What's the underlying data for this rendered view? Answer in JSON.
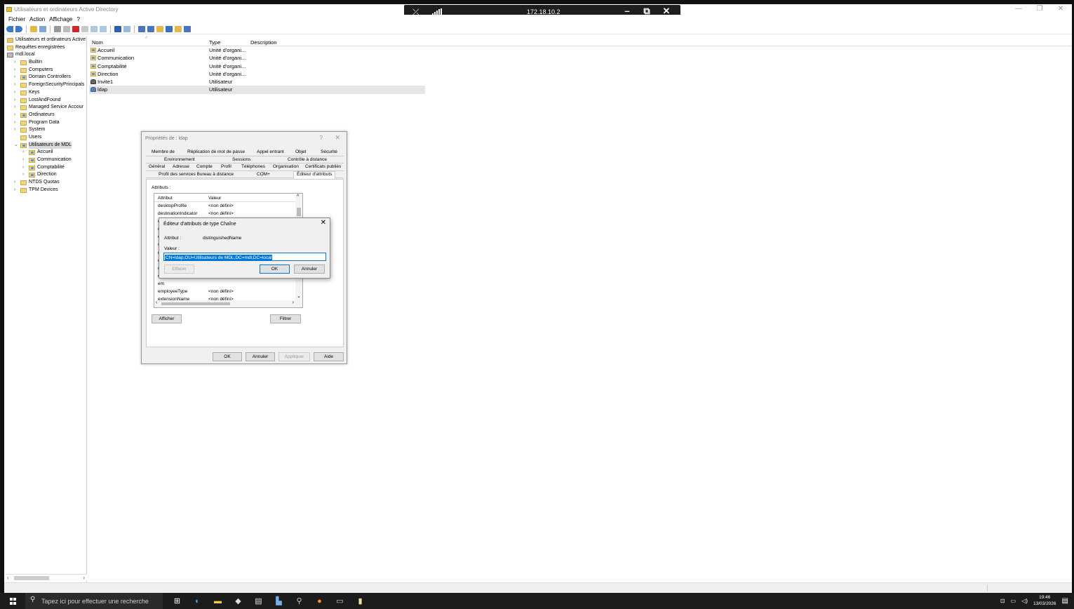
{
  "window": {
    "title": "Utilisateurs et ordinateurs Active Directory"
  },
  "rdp": {
    "ip": "172.18.10.2"
  },
  "menu": [
    "Fichier",
    "Action",
    "Affichage",
    "?"
  ],
  "tree": {
    "items": [
      {
        "label": "Utilisateurs et ordinateurs Active",
        "level": 0,
        "arrow": "",
        "icon": "root"
      },
      {
        "label": "Requêtes enregistrées",
        "level": 0,
        "arrow": "›",
        "icon": "folder"
      },
      {
        "label": "mdl.local",
        "level": 0,
        "arrow": "⌄",
        "icon": "domain"
      },
      {
        "label": "Builtin",
        "level": 1,
        "arrow": "›",
        "icon": "folder"
      },
      {
        "label": "Computers",
        "level": 1,
        "arrow": "›",
        "icon": "folder"
      },
      {
        "label": "Domain Controllers",
        "level": 1,
        "arrow": "›",
        "icon": "ou"
      },
      {
        "label": "ForeignSecurityPrincipals",
        "level": 1,
        "arrow": "›",
        "icon": "folder"
      },
      {
        "label": "Keys",
        "level": 1,
        "arrow": "›",
        "icon": "folder"
      },
      {
        "label": "LostAndFound",
        "level": 1,
        "arrow": "›",
        "icon": "folder"
      },
      {
        "label": "Managed Service Accour",
        "level": 1,
        "arrow": "›",
        "icon": "folder"
      },
      {
        "label": "Ordinateurs",
        "level": 1,
        "arrow": "›",
        "icon": "ou"
      },
      {
        "label": "Program Data",
        "level": 1,
        "arrow": "›",
        "icon": "folder"
      },
      {
        "label": "System",
        "level": 1,
        "arrow": "›",
        "icon": "folder"
      },
      {
        "label": "Users",
        "level": 1,
        "arrow": "",
        "icon": "folder"
      },
      {
        "label": "Utilisateurs de MDL",
        "level": 1,
        "arrow": "⌄",
        "icon": "ou",
        "selected": true
      },
      {
        "label": "Accueil",
        "level": 2,
        "arrow": "›",
        "icon": "ou"
      },
      {
        "label": "Communication",
        "level": 2,
        "arrow": "›",
        "icon": "ou"
      },
      {
        "label": "Comptabilité",
        "level": 2,
        "arrow": "›",
        "icon": "ou"
      },
      {
        "label": "Direction",
        "level": 2,
        "arrow": "›",
        "icon": "ou"
      },
      {
        "label": "NTDS Quotas",
        "level": 1,
        "arrow": "›",
        "icon": "folder"
      },
      {
        "label": "TPM Devices",
        "level": 1,
        "arrow": "›",
        "icon": "folder"
      }
    ]
  },
  "list": {
    "columns": {
      "name": "Nom",
      "type": "Type",
      "description": "Description"
    },
    "rows": [
      {
        "name": "Accueil",
        "type": "Unité d'organi...",
        "icon": "ou"
      },
      {
        "name": "Communication",
        "type": "Unité d'organi...",
        "icon": "ou"
      },
      {
        "name": "Comptabilité",
        "type": "Unité d'organi...",
        "icon": "ou"
      },
      {
        "name": "Direction",
        "type": "Unité d'organi...",
        "icon": "ou"
      },
      {
        "name": "Invite1",
        "type": "Utilisateur",
        "icon": "guest"
      },
      {
        "name": "ldap",
        "type": "Utilisateur",
        "icon": "user",
        "selected": true
      }
    ]
  },
  "properties": {
    "title": "Propriétés de : ldap",
    "help": "?",
    "close": "✕",
    "tabs": {
      "row1": [
        "Membre de",
        "Réplication de mot de passe",
        "Appel entrant",
        "Objet",
        "Sécurité"
      ],
      "row2": [
        "Environnement",
        "Sessions",
        "Contrôle à distance"
      ],
      "row3": [
        "Général",
        "Adresse",
        "Compte",
        "Profil",
        "Téléphones",
        "Organisation",
        "Certificats publiés"
      ],
      "row4": [
        "Profil des services Bureau à distance",
        "COM+",
        "Éditeur d'attributs"
      ]
    },
    "attributes_label": "Attributs :",
    "attr_columns": {
      "attr": "Attribut",
      "value": "Valeur"
    },
    "attrs": [
      {
        "a": "desktopProfile",
        "v": "<non défini>"
      },
      {
        "a": "destinationIndicator",
        "v": "<non défini>"
      },
      {
        "a": "di",
        "v": ""
      },
      {
        "a": "dis",
        "v": ""
      },
      {
        "a": "dis",
        "v": ""
      },
      {
        "a": "div",
        "v": ""
      },
      {
        "a": "dS",
        "v": ""
      },
      {
        "a": "dS",
        "v": ""
      },
      {
        "a": "dy",
        "v": ""
      },
      {
        "a": "em",
        "v": ""
      },
      {
        "a": "em",
        "v": ""
      },
      {
        "a": "employeeType",
        "v": "<non défini>"
      },
      {
        "a": "extensionName",
        "v": "<non défini>"
      },
      {
        "a": "facsimileTelephoneN...",
        "v": "<non défini>"
      }
    ],
    "buttons": {
      "show": "Afficher",
      "filter": "Filtrer",
      "ok": "OK",
      "cancel": "Annuler",
      "apply": "Appliquer",
      "help": "Aide"
    }
  },
  "string_editor": {
    "title": "Éditeur d'attributs de type Chaîne",
    "attr_label": "Attribut :",
    "attr_value": "distinguishedName",
    "value_label": "Valeur :",
    "value": "CN=ldap,OU=Utilisateurs de MDL,DC=mdl,DC=local",
    "clear": "Effacer",
    "ok": "OK",
    "cancel": "Annuler"
  },
  "taskbar": {
    "search_placeholder": "Tapez ici pour effectuer une recherche",
    "time": "19:46",
    "date": "13/03/2026"
  }
}
